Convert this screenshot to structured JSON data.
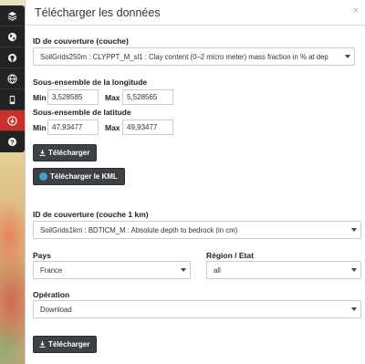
{
  "panel": {
    "title": "Télécharger les données",
    "close_label": "×"
  },
  "toolbar": {
    "items": [
      {
        "icon": "layers-icon"
      },
      {
        "icon": "globe-icon"
      },
      {
        "icon": "github-icon"
      },
      {
        "icon": "world-icon"
      },
      {
        "icon": "mobile-icon"
      },
      {
        "icon": "download-circle-icon"
      },
      {
        "icon": "help-icon"
      }
    ],
    "active_index": 5
  },
  "form1": {
    "coverage_label": "ID de couverture (couche)",
    "coverage_value": "SoilGrids250m : CLYPPT_M_sl1 : Clay content (0–2 micro meter) mass fraction in % at dep",
    "longitude_label": "Sous-ensemble de la longitude",
    "lon_min_label": "Min",
    "lon_min_value": "3,528585",
    "lon_max_label": "Max",
    "lon_max_value": "5,528565",
    "latitude_label": "Sous-ensemble de latitude",
    "lat_min_label": "Min",
    "lat_min_value": "47,93477",
    "lat_max_label": "Max",
    "lat_max_value": "49,93477",
    "download_button": "Télécharger",
    "kml_button": "Télécharger le KML"
  },
  "form2": {
    "coverage_label": "ID de couverture (couche 1 km)",
    "coverage_value": "SoilGrids1km : BDTICM_M : Absolute depth to bedrock (in cm)",
    "country_label": "Pays",
    "country_value": "France",
    "region_label": "Région / Etat",
    "region_value": "all",
    "operation_label": "Opération",
    "operation_value": "Download",
    "download_button": "Télécharger"
  }
}
